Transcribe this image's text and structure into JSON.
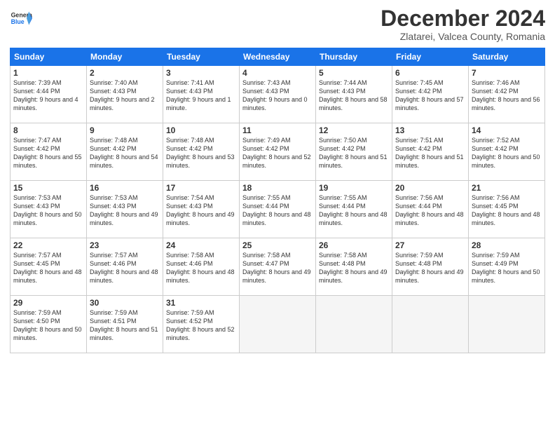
{
  "header": {
    "logo_general": "General",
    "logo_blue": "Blue",
    "month_title": "December 2024",
    "subtitle": "Zlatarei, Valcea County, Romania"
  },
  "days_of_week": [
    "Sunday",
    "Monday",
    "Tuesday",
    "Wednesday",
    "Thursday",
    "Friday",
    "Saturday"
  ],
  "weeks": [
    [
      {
        "day": "1",
        "sunrise": "7:39 AM",
        "sunset": "4:44 PM",
        "daylight": "9 hours and 4 minutes."
      },
      {
        "day": "2",
        "sunrise": "7:40 AM",
        "sunset": "4:43 PM",
        "daylight": "9 hours and 2 minutes."
      },
      {
        "day": "3",
        "sunrise": "7:41 AM",
        "sunset": "4:43 PM",
        "daylight": "9 hours and 1 minute."
      },
      {
        "day": "4",
        "sunrise": "7:43 AM",
        "sunset": "4:43 PM",
        "daylight": "9 hours and 0 minutes."
      },
      {
        "day": "5",
        "sunrise": "7:44 AM",
        "sunset": "4:43 PM",
        "daylight": "8 hours and 58 minutes."
      },
      {
        "day": "6",
        "sunrise": "7:45 AM",
        "sunset": "4:42 PM",
        "daylight": "8 hours and 57 minutes."
      },
      {
        "day": "7",
        "sunrise": "7:46 AM",
        "sunset": "4:42 PM",
        "daylight": "8 hours and 56 minutes."
      }
    ],
    [
      {
        "day": "8",
        "sunrise": "7:47 AM",
        "sunset": "4:42 PM",
        "daylight": "8 hours and 55 minutes."
      },
      {
        "day": "9",
        "sunrise": "7:48 AM",
        "sunset": "4:42 PM",
        "daylight": "8 hours and 54 minutes."
      },
      {
        "day": "10",
        "sunrise": "7:48 AM",
        "sunset": "4:42 PM",
        "daylight": "8 hours and 53 minutes."
      },
      {
        "day": "11",
        "sunrise": "7:49 AM",
        "sunset": "4:42 PM",
        "daylight": "8 hours and 52 minutes."
      },
      {
        "day": "12",
        "sunrise": "7:50 AM",
        "sunset": "4:42 PM",
        "daylight": "8 hours and 51 minutes."
      },
      {
        "day": "13",
        "sunrise": "7:51 AM",
        "sunset": "4:42 PM",
        "daylight": "8 hours and 51 minutes."
      },
      {
        "day": "14",
        "sunrise": "7:52 AM",
        "sunset": "4:42 PM",
        "daylight": "8 hours and 50 minutes."
      }
    ],
    [
      {
        "day": "15",
        "sunrise": "7:53 AM",
        "sunset": "4:43 PM",
        "daylight": "8 hours and 50 minutes."
      },
      {
        "day": "16",
        "sunrise": "7:53 AM",
        "sunset": "4:43 PM",
        "daylight": "8 hours and 49 minutes."
      },
      {
        "day": "17",
        "sunrise": "7:54 AM",
        "sunset": "4:43 PM",
        "daylight": "8 hours and 49 minutes."
      },
      {
        "day": "18",
        "sunrise": "7:55 AM",
        "sunset": "4:44 PM",
        "daylight": "8 hours and 48 minutes."
      },
      {
        "day": "19",
        "sunrise": "7:55 AM",
        "sunset": "4:44 PM",
        "daylight": "8 hours and 48 minutes."
      },
      {
        "day": "20",
        "sunrise": "7:56 AM",
        "sunset": "4:44 PM",
        "daylight": "8 hours and 48 minutes."
      },
      {
        "day": "21",
        "sunrise": "7:56 AM",
        "sunset": "4:45 PM",
        "daylight": "8 hours and 48 minutes."
      }
    ],
    [
      {
        "day": "22",
        "sunrise": "7:57 AM",
        "sunset": "4:45 PM",
        "daylight": "8 hours and 48 minutes."
      },
      {
        "day": "23",
        "sunrise": "7:57 AM",
        "sunset": "4:46 PM",
        "daylight": "8 hours and 48 minutes."
      },
      {
        "day": "24",
        "sunrise": "7:58 AM",
        "sunset": "4:46 PM",
        "daylight": "8 hours and 48 minutes."
      },
      {
        "day": "25",
        "sunrise": "7:58 AM",
        "sunset": "4:47 PM",
        "daylight": "8 hours and 49 minutes."
      },
      {
        "day": "26",
        "sunrise": "7:58 AM",
        "sunset": "4:48 PM",
        "daylight": "8 hours and 49 minutes."
      },
      {
        "day": "27",
        "sunrise": "7:59 AM",
        "sunset": "4:48 PM",
        "daylight": "8 hours and 49 minutes."
      },
      {
        "day": "28",
        "sunrise": "7:59 AM",
        "sunset": "4:49 PM",
        "daylight": "8 hours and 50 minutes."
      }
    ],
    [
      {
        "day": "29",
        "sunrise": "7:59 AM",
        "sunset": "4:50 PM",
        "daylight": "8 hours and 50 minutes."
      },
      {
        "day": "30",
        "sunrise": "7:59 AM",
        "sunset": "4:51 PM",
        "daylight": "8 hours and 51 minutes."
      },
      {
        "day": "31",
        "sunrise": "7:59 AM",
        "sunset": "4:52 PM",
        "daylight": "8 hours and 52 minutes."
      },
      null,
      null,
      null,
      null
    ]
  ]
}
